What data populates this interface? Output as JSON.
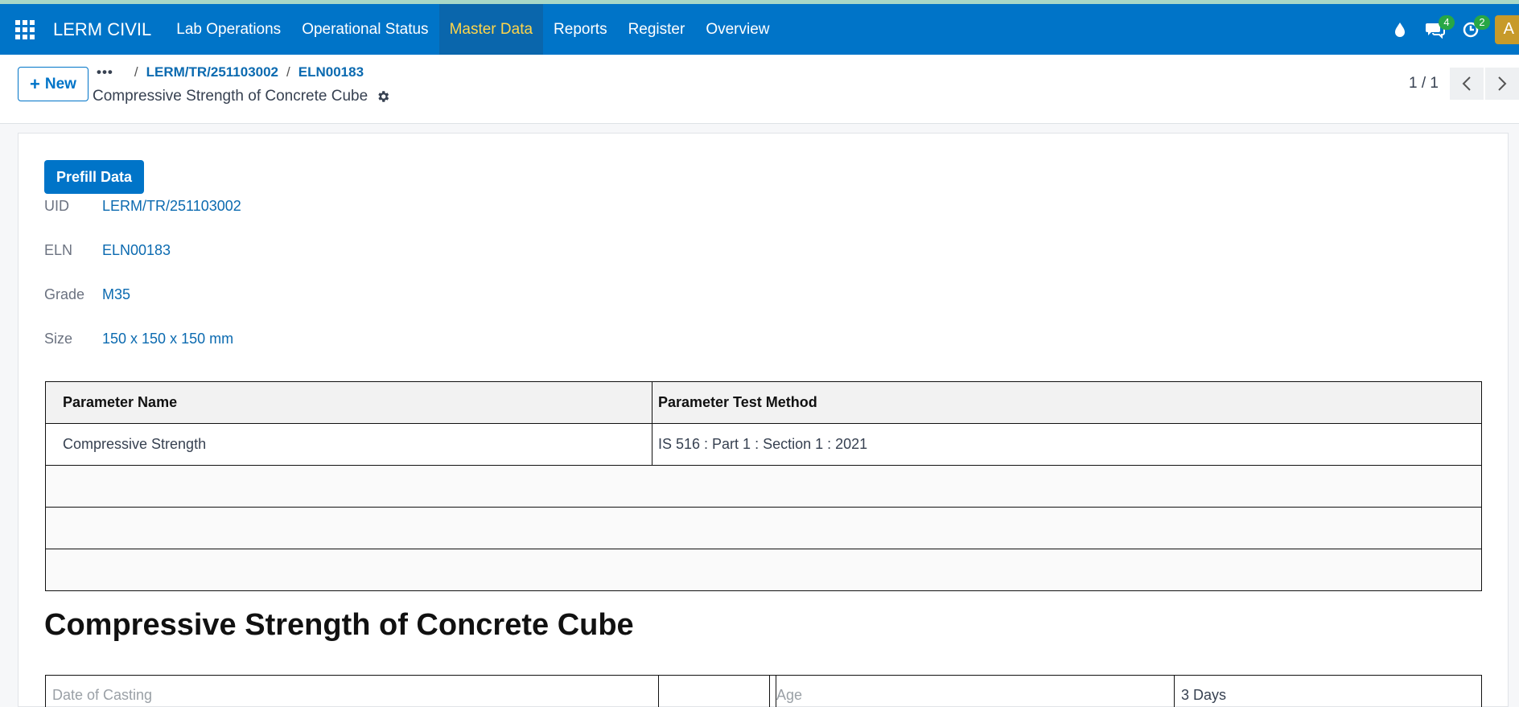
{
  "nav": {
    "brand": "LERM CIVIL",
    "items": [
      {
        "label": "Lab Operations",
        "active": false
      },
      {
        "label": "Operational Status",
        "active": false
      },
      {
        "label": "Master Data",
        "active": true
      },
      {
        "label": "Reports",
        "active": false
      },
      {
        "label": "Register",
        "active": false
      },
      {
        "label": "Overview",
        "active": false
      }
    ],
    "icons": {
      "app": "apps-grid-icon",
      "debug": "droplet-icon",
      "messages": "chat-icon",
      "activities": "clock-icon"
    },
    "messages_badge": "4",
    "activities_badge": "2",
    "avatar_initial": "A",
    "colors": {
      "navbar": "#0074c8",
      "active_text": "#ffd54a",
      "badge": "#28a745",
      "avatar": "#c79a2a"
    }
  },
  "control": {
    "new_label": "New",
    "breadcrumb": {
      "dots": "•••",
      "items": [
        "LERM/TR/251103002",
        "ELN00183"
      ],
      "separator": "/"
    },
    "record_title": "Compressive Strength of Concrete Cube",
    "pager": "1 / 1"
  },
  "form": {
    "prefill_label": "Prefill Data",
    "fields": [
      {
        "label": "UID",
        "value": "LERM/TR/251103002"
      },
      {
        "label": "ELN",
        "value": "ELN00183"
      },
      {
        "label": "Grade",
        "value": "M35"
      },
      {
        "label": "Size",
        "value": "150 x 150 x 150 mm"
      }
    ],
    "param_table": {
      "headers": [
        "Parameter Name",
        "Parameter Test Method"
      ],
      "rows": [
        [
          "Compressive Strength",
          "IS 516 : Part 1 : Section 1 : 2021"
        ]
      ]
    },
    "section_title": "Compressive Strength of Concrete Cube",
    "casting": {
      "date_label": "Date of Casting",
      "date_value": "",
      "age_label": "Age",
      "age_value": "3 Days"
    }
  }
}
